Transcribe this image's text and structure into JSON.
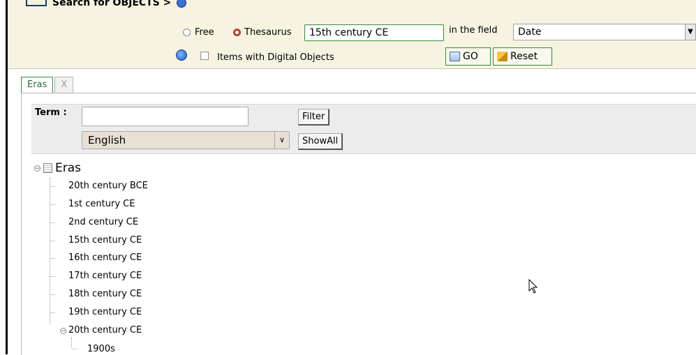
{
  "search_panel": {
    "heading": "Search for OBJECTS >",
    "mode_free_label": "Free",
    "mode_thesaurus_label": "Thesaurus",
    "selected_mode": "Thesaurus",
    "query_value": "15th century CE",
    "in_field_label": "in the field",
    "field_value": "Date",
    "digital_objects_label": "Items with Digital Objects",
    "go_label": "GO",
    "reset_label": "Reset"
  },
  "tabs": [
    {
      "label": "Eras",
      "active": true
    },
    {
      "label": "X",
      "active": false
    }
  ],
  "filter": {
    "term_label": "Term :",
    "term_value": "",
    "filter_label": "Filter",
    "language_value": "English",
    "showall_label": "ShowAll"
  },
  "tree": {
    "root_label": "Eras",
    "nodes": [
      "20th century BCE",
      "1st century CE",
      "2nd century CE",
      "15th century CE",
      "16th century CE",
      "17th century CE",
      "18th century CE",
      "19th century CE",
      "20th century CE"
    ],
    "expanded_node": "20th century CE",
    "child_nodes": [
      "1900s"
    ]
  }
}
